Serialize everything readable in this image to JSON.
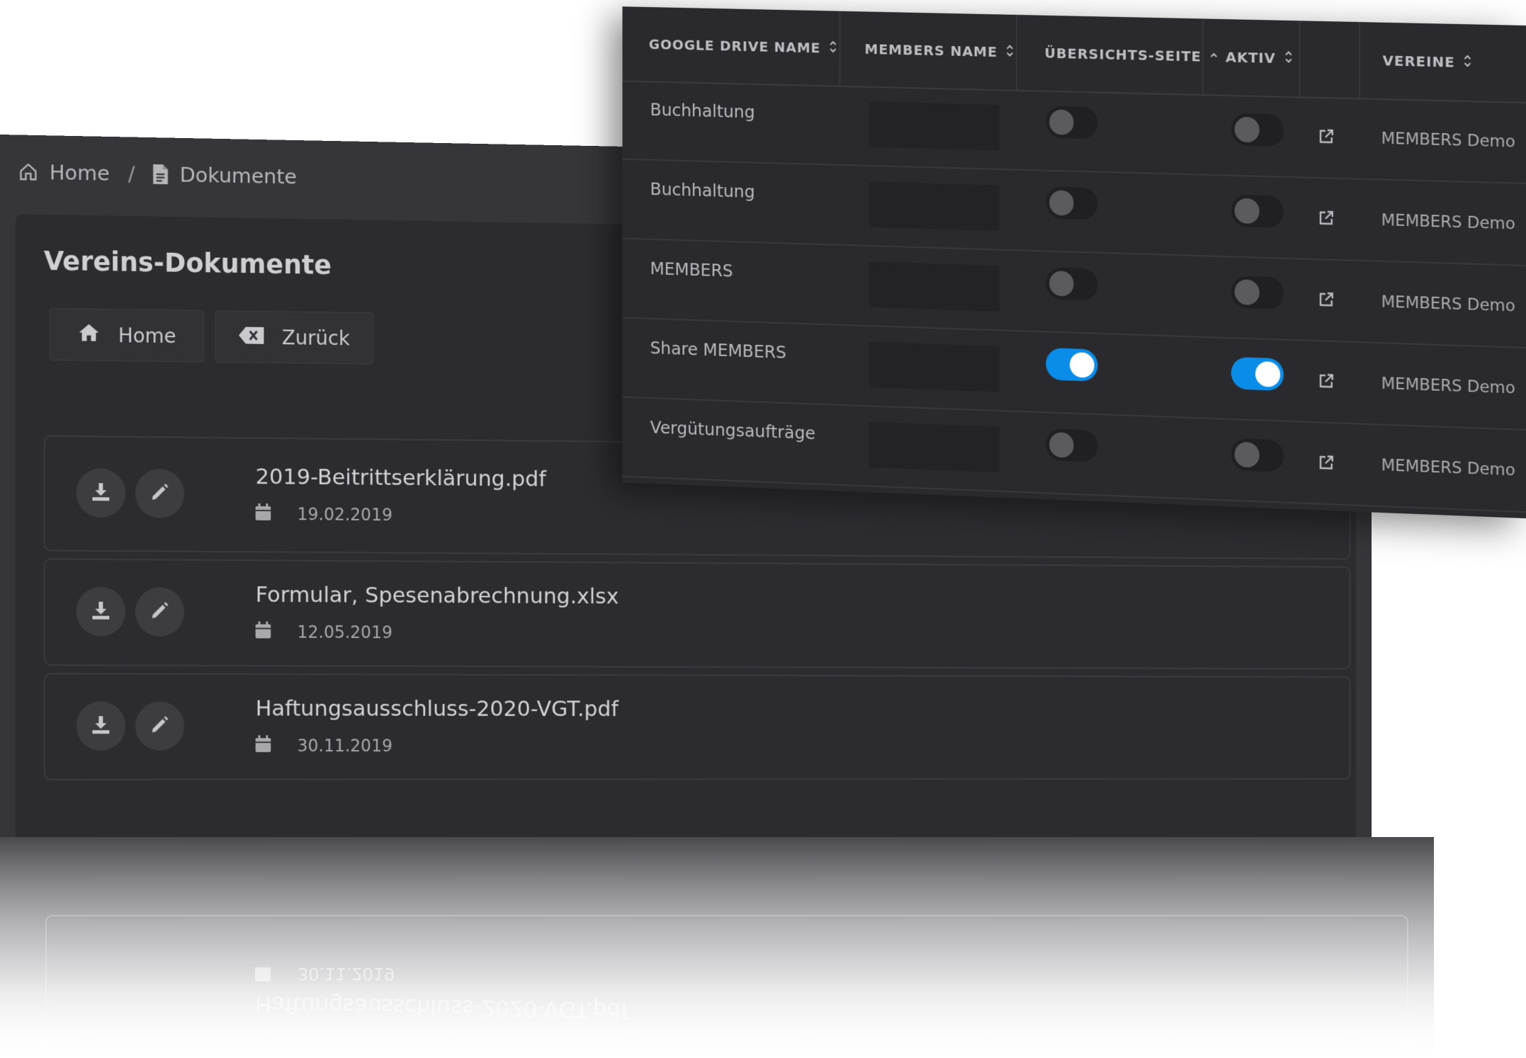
{
  "breadcrumb": {
    "home": "Home",
    "separator": "/",
    "current": "Dokumente"
  },
  "documents_panel": {
    "title": "Vereins-Dokumente",
    "buttons": {
      "home": "Home",
      "back": "Zurück"
    },
    "files": [
      {
        "name": "2019-Beitrittserklärung.pdf",
        "date": "19.02.2019"
      },
      {
        "name": "Formular, Spesenabrechnung.xlsx",
        "date": "12.05.2019"
      },
      {
        "name": "Haftungsausschluss-2020-VGT.pdf",
        "date": "30.11.2019"
      }
    ]
  },
  "table": {
    "headers": {
      "google_drive_name": "GOOGLE DRIVE NAME",
      "members_name": "MEMBERS NAME",
      "uebersicht": "ÜBERSICHTS-SEITE",
      "aktiv": "AKTIV",
      "vereine": "VEREINE"
    },
    "rows": [
      {
        "name": "Buchhaltung",
        "uebersicht": false,
        "aktiv": false,
        "verein": "MEMBERS Demo"
      },
      {
        "name": "Buchhaltung",
        "uebersicht": false,
        "aktiv": false,
        "verein": "MEMBERS Demo"
      },
      {
        "name": "MEMBERS",
        "uebersicht": false,
        "aktiv": false,
        "verein": "MEMBERS Demo"
      },
      {
        "name": "Share MEMBERS",
        "uebersicht": true,
        "aktiv": true,
        "verein": "MEMBERS Demo"
      },
      {
        "name": "Vergütungsaufträge",
        "uebersicht": false,
        "aktiv": false,
        "verein": "MEMBERS Demo"
      }
    ]
  },
  "colors": {
    "toggle_on": "#0a8de8",
    "panel_bg": "#2a2a2e",
    "card_bg": "#2c2c30"
  },
  "icons": [
    "home-outline-icon",
    "document-icon",
    "home-icon",
    "backspace-icon",
    "download-icon",
    "pencil-icon",
    "calendar-icon",
    "sort-icon",
    "sort-up-icon",
    "external-link-icon"
  ]
}
